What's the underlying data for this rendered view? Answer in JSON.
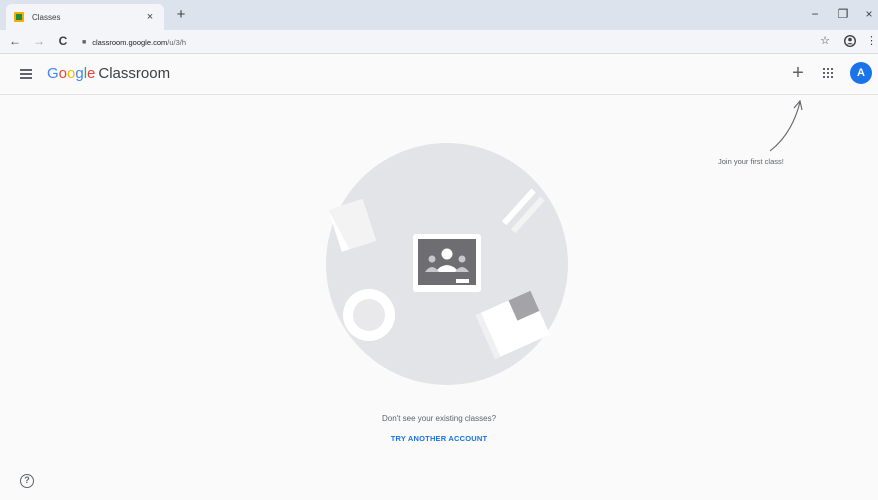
{
  "tab": {
    "title": "Classes",
    "close": "×",
    "new_tab": "+"
  },
  "window_controls": {
    "minimize": "−",
    "restore": "❐",
    "close": "×"
  },
  "address_bar": {
    "url_host": "classroom.google.com",
    "url_path": "/u/3/h"
  },
  "nav": {
    "back": "←",
    "forward": "→",
    "reload": "C"
  },
  "toolbar_right": {
    "bookmark": "☆",
    "profile": "●",
    "menu": "⋮"
  },
  "app": {
    "logo_letters": [
      "G",
      "o",
      "o",
      "g",
      "l",
      "e"
    ],
    "product_name": "Classroom",
    "add_label": "+",
    "avatar_initial": "A"
  },
  "hint": {
    "text": "Join your first class!"
  },
  "empty_state": {
    "message": "Don't see your existing classes?",
    "action": "TRY ANOTHER ACCOUNT"
  },
  "help": {
    "label": "?"
  },
  "colors": {
    "accent": "#1a73e8",
    "illustration_bg": "#e3e4e8",
    "board": "#6e6e72"
  },
  "icons": [
    "menu-icon",
    "add-icon",
    "apps-grid-icon",
    "help-icon",
    "lock-icon",
    "star-icon",
    "profile-icon",
    "more-vert-icon"
  ]
}
